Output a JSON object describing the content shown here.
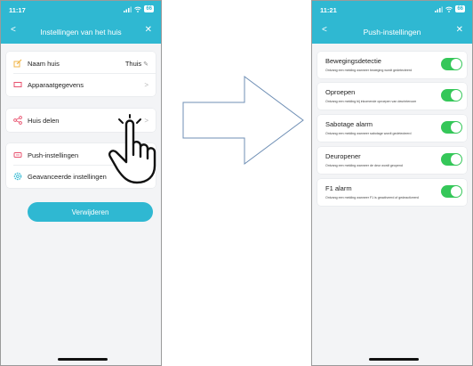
{
  "left_screen": {
    "status_time": "11:17",
    "battery": "66",
    "title": "Instellingen van het huis",
    "close_symbol": "✕",
    "back_symbol": "<",
    "items": [
      {
        "label": "Naam huis",
        "value": "Thuis",
        "icon": "house-edit-icon",
        "color": "#f0b64a"
      },
      {
        "label": "Apparaatgegevens",
        "icon": "device-info-icon",
        "color": "#e8516e"
      },
      {
        "label": "Huis delen",
        "icon": "share-icon",
        "color": "#e8516e"
      },
      {
        "label": "Push-instellingen",
        "icon": "notification-icon",
        "color": "#e8516e"
      },
      {
        "label": "Geavanceerde instellingen",
        "icon": "settings-gear-icon",
        "color": "#2fb8d2"
      }
    ],
    "delete_button": "Verwijderen"
  },
  "right_screen": {
    "status_time": "11:21",
    "battery": "66",
    "title": "Push-instellingen",
    "close_symbol": "✕",
    "back_symbol": "<",
    "settings": [
      {
        "title": "Bewegingsdetectie",
        "description": "Ontvang een melding wanneer beweging wordt gedetecteerd",
        "enabled": true
      },
      {
        "title": "Oproepen",
        "description": "Ontvang een melding bij inkomende oproepen van deurintercom",
        "enabled": true
      },
      {
        "title": "Sabotage alarm",
        "description": "Ontvang een melding wanneer sabotage wordt gedetecteerd",
        "enabled": true
      },
      {
        "title": "Deuropener",
        "description": "Ontvang een melding wanneer de deur wordt geopend",
        "enabled": true
      },
      {
        "title": "F1 alarm",
        "description": "Ontvang een melding wanneer F1 is geactiveerd of gedeactiveerd",
        "enabled": true
      }
    ]
  },
  "colors": {
    "accent": "#2fb8d2",
    "toggle_on": "#35c759",
    "background": "#f3f4f6"
  }
}
